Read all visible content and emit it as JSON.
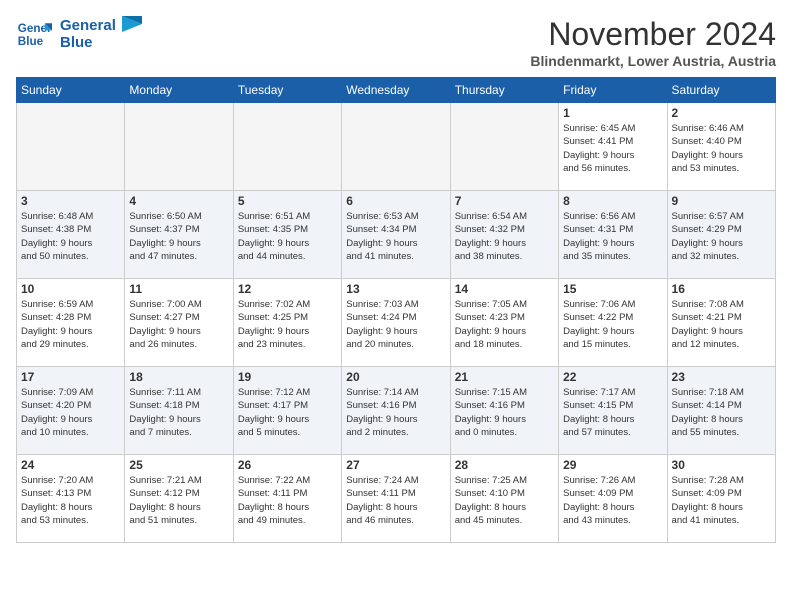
{
  "header": {
    "logo_line1": "General",
    "logo_line2": "Blue",
    "month_title": "November 2024",
    "location": "Blindenmarkt, Lower Austria, Austria"
  },
  "weekdays": [
    "Sunday",
    "Monday",
    "Tuesday",
    "Wednesday",
    "Thursday",
    "Friday",
    "Saturday"
  ],
  "weeks": [
    [
      {
        "day": "",
        "info": ""
      },
      {
        "day": "",
        "info": ""
      },
      {
        "day": "",
        "info": ""
      },
      {
        "day": "",
        "info": ""
      },
      {
        "day": "",
        "info": ""
      },
      {
        "day": "1",
        "info": "Sunrise: 6:45 AM\nSunset: 4:41 PM\nDaylight: 9 hours\nand 56 minutes."
      },
      {
        "day": "2",
        "info": "Sunrise: 6:46 AM\nSunset: 4:40 PM\nDaylight: 9 hours\nand 53 minutes."
      }
    ],
    [
      {
        "day": "3",
        "info": "Sunrise: 6:48 AM\nSunset: 4:38 PM\nDaylight: 9 hours\nand 50 minutes."
      },
      {
        "day": "4",
        "info": "Sunrise: 6:50 AM\nSunset: 4:37 PM\nDaylight: 9 hours\nand 47 minutes."
      },
      {
        "day": "5",
        "info": "Sunrise: 6:51 AM\nSunset: 4:35 PM\nDaylight: 9 hours\nand 44 minutes."
      },
      {
        "day": "6",
        "info": "Sunrise: 6:53 AM\nSunset: 4:34 PM\nDaylight: 9 hours\nand 41 minutes."
      },
      {
        "day": "7",
        "info": "Sunrise: 6:54 AM\nSunset: 4:32 PM\nDaylight: 9 hours\nand 38 minutes."
      },
      {
        "day": "8",
        "info": "Sunrise: 6:56 AM\nSunset: 4:31 PM\nDaylight: 9 hours\nand 35 minutes."
      },
      {
        "day": "9",
        "info": "Sunrise: 6:57 AM\nSunset: 4:29 PM\nDaylight: 9 hours\nand 32 minutes."
      }
    ],
    [
      {
        "day": "10",
        "info": "Sunrise: 6:59 AM\nSunset: 4:28 PM\nDaylight: 9 hours\nand 29 minutes."
      },
      {
        "day": "11",
        "info": "Sunrise: 7:00 AM\nSunset: 4:27 PM\nDaylight: 9 hours\nand 26 minutes."
      },
      {
        "day": "12",
        "info": "Sunrise: 7:02 AM\nSunset: 4:25 PM\nDaylight: 9 hours\nand 23 minutes."
      },
      {
        "day": "13",
        "info": "Sunrise: 7:03 AM\nSunset: 4:24 PM\nDaylight: 9 hours\nand 20 minutes."
      },
      {
        "day": "14",
        "info": "Sunrise: 7:05 AM\nSunset: 4:23 PM\nDaylight: 9 hours\nand 18 minutes."
      },
      {
        "day": "15",
        "info": "Sunrise: 7:06 AM\nSunset: 4:22 PM\nDaylight: 9 hours\nand 15 minutes."
      },
      {
        "day": "16",
        "info": "Sunrise: 7:08 AM\nSunset: 4:21 PM\nDaylight: 9 hours\nand 12 minutes."
      }
    ],
    [
      {
        "day": "17",
        "info": "Sunrise: 7:09 AM\nSunset: 4:20 PM\nDaylight: 9 hours\nand 10 minutes."
      },
      {
        "day": "18",
        "info": "Sunrise: 7:11 AM\nSunset: 4:18 PM\nDaylight: 9 hours\nand 7 minutes."
      },
      {
        "day": "19",
        "info": "Sunrise: 7:12 AM\nSunset: 4:17 PM\nDaylight: 9 hours\nand 5 minutes."
      },
      {
        "day": "20",
        "info": "Sunrise: 7:14 AM\nSunset: 4:16 PM\nDaylight: 9 hours\nand 2 minutes."
      },
      {
        "day": "21",
        "info": "Sunrise: 7:15 AM\nSunset: 4:16 PM\nDaylight: 9 hours\nand 0 minutes."
      },
      {
        "day": "22",
        "info": "Sunrise: 7:17 AM\nSunset: 4:15 PM\nDaylight: 8 hours\nand 57 minutes."
      },
      {
        "day": "23",
        "info": "Sunrise: 7:18 AM\nSunset: 4:14 PM\nDaylight: 8 hours\nand 55 minutes."
      }
    ],
    [
      {
        "day": "24",
        "info": "Sunrise: 7:20 AM\nSunset: 4:13 PM\nDaylight: 8 hours\nand 53 minutes."
      },
      {
        "day": "25",
        "info": "Sunrise: 7:21 AM\nSunset: 4:12 PM\nDaylight: 8 hours\nand 51 minutes."
      },
      {
        "day": "26",
        "info": "Sunrise: 7:22 AM\nSunset: 4:11 PM\nDaylight: 8 hours\nand 49 minutes."
      },
      {
        "day": "27",
        "info": "Sunrise: 7:24 AM\nSunset: 4:11 PM\nDaylight: 8 hours\nand 46 minutes."
      },
      {
        "day": "28",
        "info": "Sunrise: 7:25 AM\nSunset: 4:10 PM\nDaylight: 8 hours\nand 45 minutes."
      },
      {
        "day": "29",
        "info": "Sunrise: 7:26 AM\nSunset: 4:09 PM\nDaylight: 8 hours\nand 43 minutes."
      },
      {
        "day": "30",
        "info": "Sunrise: 7:28 AM\nSunset: 4:09 PM\nDaylight: 8 hours\nand 41 minutes."
      }
    ]
  ]
}
